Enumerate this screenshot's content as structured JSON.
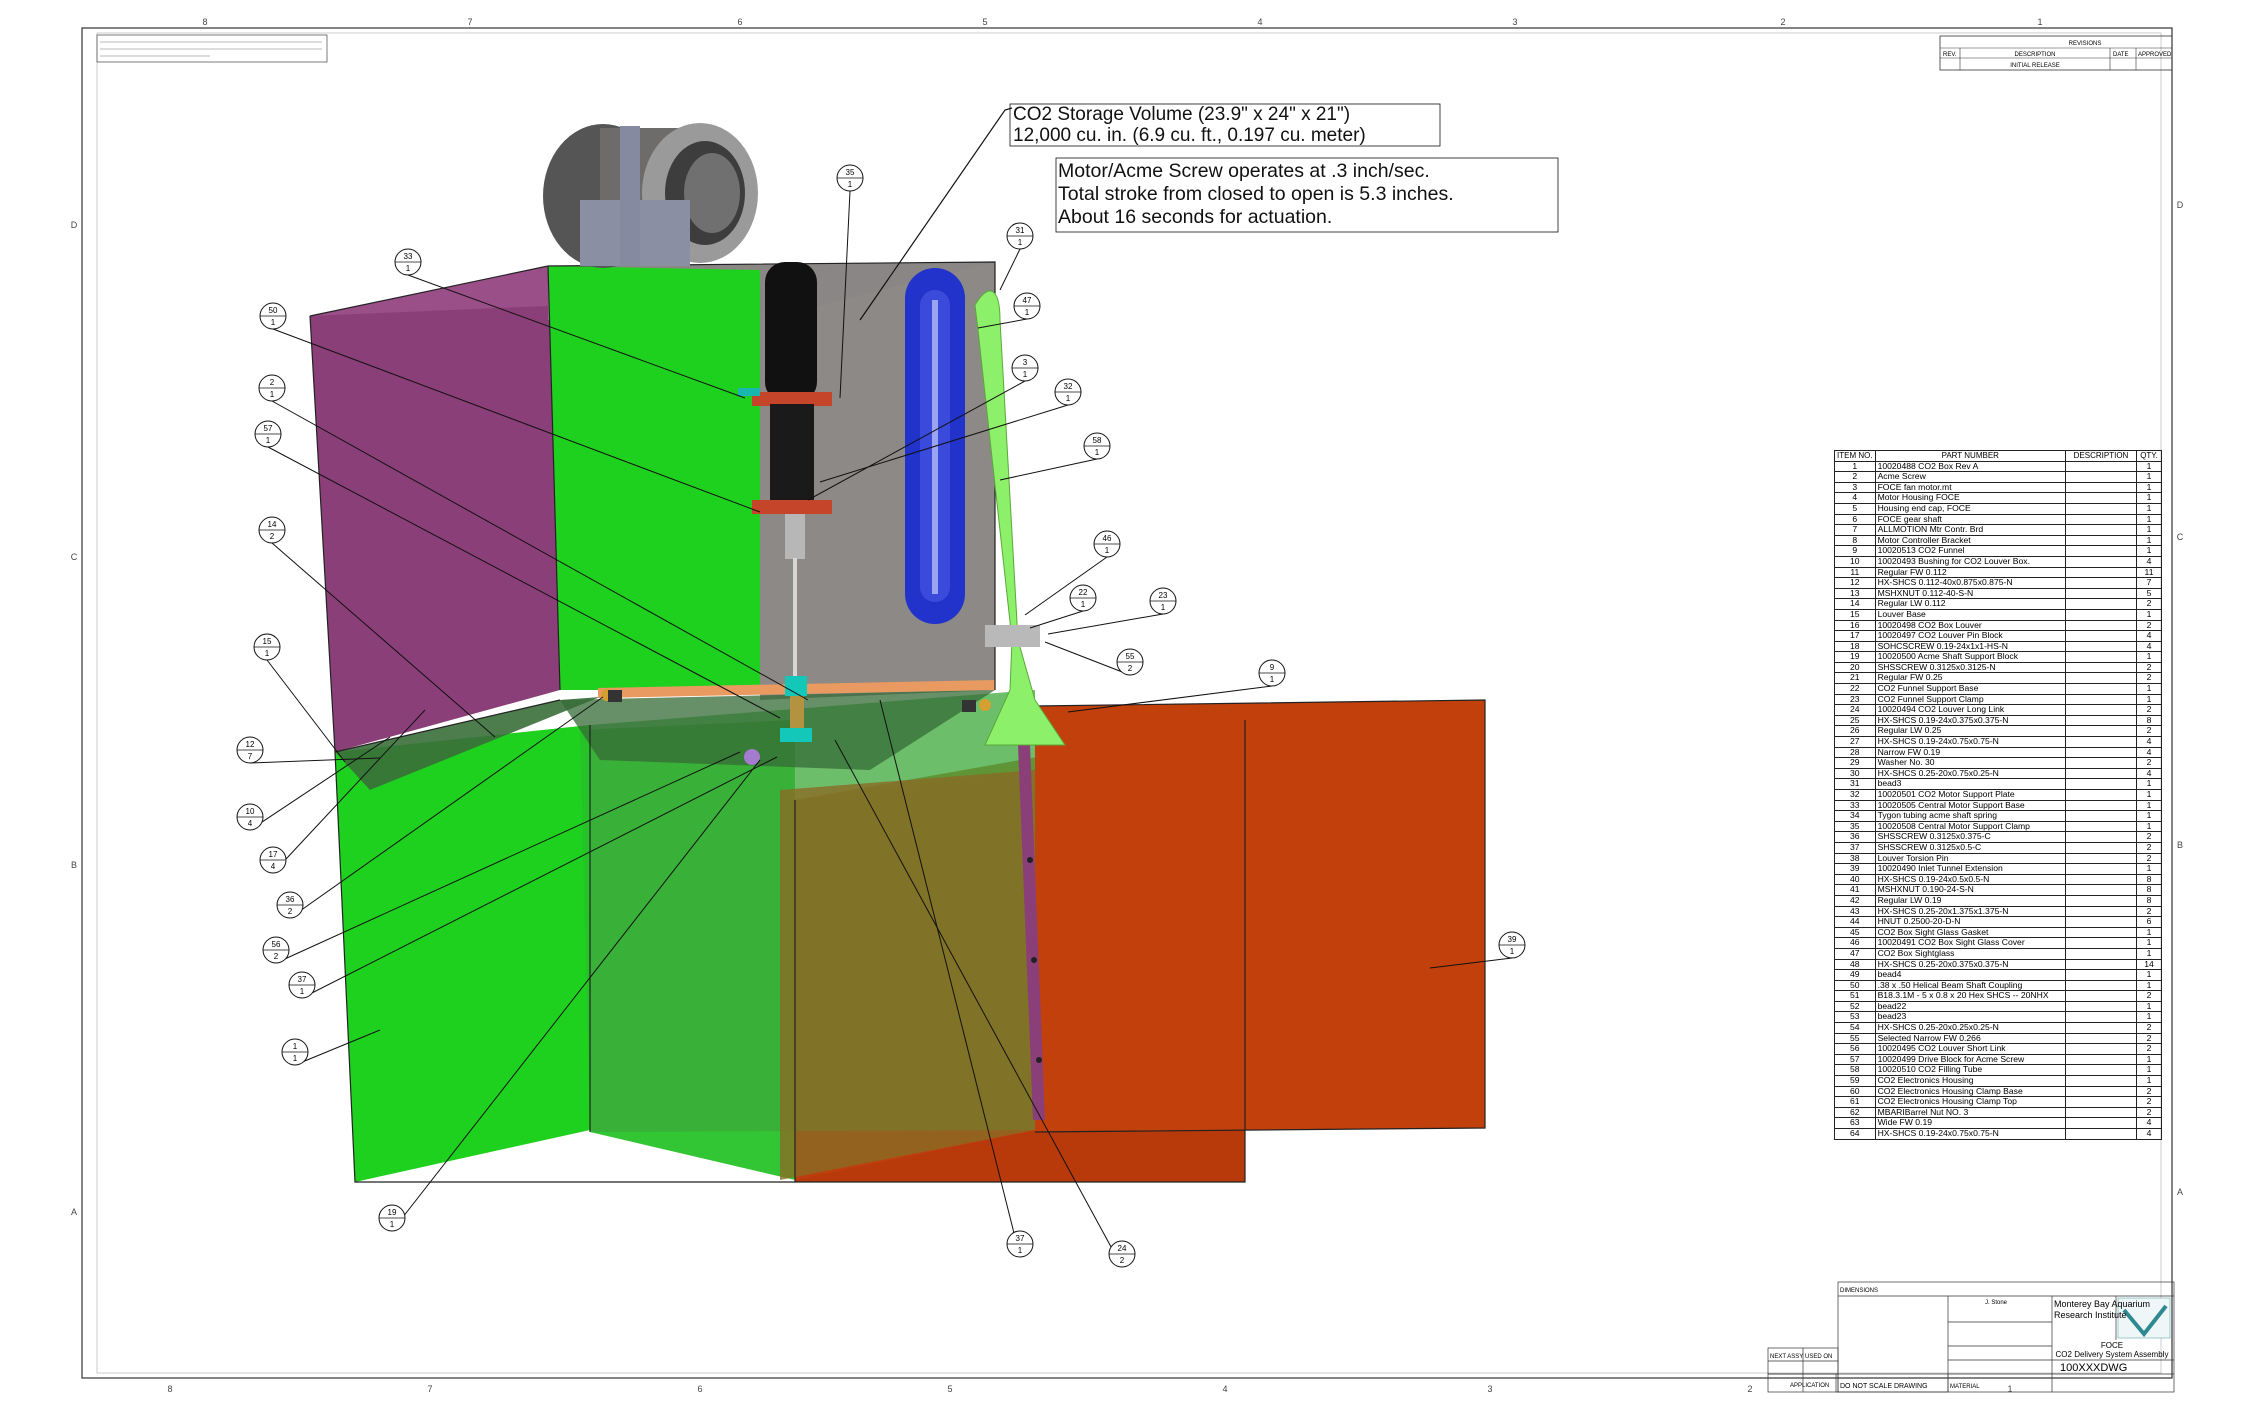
{
  "notes": {
    "storage_line1": "CO2 Storage Volume (23.9\" x 24\" x 21\")",
    "storage_line2": "12,000 cu. in. (6.9 cu. ft., 0.197 cu. meter)",
    "motor_line1": "Motor/Acme Screw  operates at .3 inch/sec.",
    "motor_line2": "Total stroke from closed to open is 5.3 inches.",
    "motor_line3": "About 16 seconds for actuation."
  },
  "colors": {
    "green": "#1fd11f",
    "purple": "#8b3f78",
    "orange": "#c2400c",
    "gray": "#8a8685",
    "blue": "#2233cc",
    "light_green": "#8df06a"
  },
  "balloons": [
    {
      "num": "35",
      "qty": "1"
    },
    {
      "num": "33",
      "qty": "1"
    },
    {
      "num": "50",
      "qty": "1"
    },
    {
      "num": "2",
      "qty": "1"
    },
    {
      "num": "57",
      "qty": "1"
    },
    {
      "num": "14",
      "qty": "2"
    },
    {
      "num": "15",
      "qty": "1"
    },
    {
      "num": "12",
      "qty": "7"
    },
    {
      "num": "10",
      "qty": "4"
    },
    {
      "num": "17",
      "qty": "4"
    },
    {
      "num": "36",
      "qty": "2"
    },
    {
      "num": "56",
      "qty": "2"
    },
    {
      "num": "37",
      "qty": "1"
    },
    {
      "num": "1",
      "qty": "1"
    },
    {
      "num": "19",
      "qty": "1"
    },
    {
      "num": "37",
      "qty": "1"
    },
    {
      "num": "24",
      "qty": "2"
    },
    {
      "num": "31",
      "qty": "1"
    },
    {
      "num": "47",
      "qty": "1"
    },
    {
      "num": "3",
      "qty": "1"
    },
    {
      "num": "32",
      "qty": "1"
    },
    {
      "num": "58",
      "qty": "1"
    },
    {
      "num": "46",
      "qty": "1"
    },
    {
      "num": "22",
      "qty": "1"
    },
    {
      "num": "23",
      "qty": "1"
    },
    {
      "num": "55",
      "qty": "2"
    },
    {
      "num": "9",
      "qty": "1"
    },
    {
      "num": "39",
      "qty": "1"
    }
  ],
  "border_letters": {
    "left": [
      "D",
      "C",
      "B",
      "A"
    ],
    "right": [
      "D",
      "C",
      "B",
      "A"
    ],
    "top": [
      "8",
      "7",
      "6",
      "5",
      "4",
      "3",
      "2",
      "1"
    ],
    "bottom": [
      "8",
      "7",
      "6",
      "5",
      "4",
      "3",
      "2",
      "1"
    ]
  },
  "bom": {
    "headers": [
      "ITEM NO.",
      "PART NUMBER",
      "DESCRIPTION",
      "QTY."
    ],
    "rows": [
      [
        "1",
        "10020488 CO2 Box Rev A",
        "",
        "1"
      ],
      [
        "2",
        "Acme Screw",
        "",
        "1"
      ],
      [
        "3",
        "FOCE fan motor.mt",
        "",
        "1"
      ],
      [
        "4",
        "Motor Housing FOCE",
        "",
        "1"
      ],
      [
        "5",
        "Housing end cap, FOCE",
        "",
        "1"
      ],
      [
        "6",
        "FOCE gear shaft",
        "",
        "1"
      ],
      [
        "7",
        "ALLMOTION Mtr Contr. Brd",
        "",
        "1"
      ],
      [
        "8",
        "Motor Controller Bracket",
        "",
        "1"
      ],
      [
        "9",
        "10020513 CO2 Funnel",
        "",
        "1"
      ],
      [
        "10",
        "10020493 Bushing for CO2 Louver Box.",
        "",
        "4"
      ],
      [
        "11",
        "Regular FW 0.112",
        "",
        "11"
      ],
      [
        "12",
        "HX-SHCS 0.112-40x0.875x0.875-N",
        "",
        "7"
      ],
      [
        "13",
        "MSHXNUT 0.112-40-S-N",
        "",
        "5"
      ],
      [
        "14",
        "Regular LW 0.112",
        "",
        "2"
      ],
      [
        "15",
        "Louver Base",
        "",
        "1"
      ],
      [
        "16",
        "10020498 CO2 Box Louver",
        "",
        "2"
      ],
      [
        "17",
        "10020497 CO2 Louver Pin Block",
        "",
        "4"
      ],
      [
        "18",
        "SOHCSCREW 0.19-24x1x1-HS-N",
        "",
        "4"
      ],
      [
        "19",
        "10020500 Acme Shaft Support Block",
        "",
        "1"
      ],
      [
        "20",
        "SHSSCREW 0.3125x0.3125-N",
        "",
        "2"
      ],
      [
        "21",
        "Regular FW 0.25",
        "",
        "2"
      ],
      [
        "22",
        "CO2 Funnel Support Base",
        "",
        "1"
      ],
      [
        "23",
        "CO2 Funnel Support Clamp",
        "",
        "1"
      ],
      [
        "24",
        "10020494 CO2 Louver Long Link",
        "",
        "2"
      ],
      [
        "25",
        "HX-SHCS 0.19-24x0.375x0.375-N",
        "",
        "8"
      ],
      [
        "26",
        "Regular LW 0.25",
        "",
        "2"
      ],
      [
        "27",
        "HX-SHCS 0.19-24x0.75x0.75-N",
        "",
        "4"
      ],
      [
        "28",
        "Narrow FW 0.19",
        "",
        "4"
      ],
      [
        "29",
        "Washer No. 30",
        "",
        "2"
      ],
      [
        "30",
        "HX-SHCS 0.25-20x0.75x0.25-N",
        "",
        "4"
      ],
      [
        "31",
        "bead3",
        "",
        "1"
      ],
      [
        "32",
        "10020501 CO2 Motor Support Plate",
        "",
        "1"
      ],
      [
        "33",
        "10020505 Central Motor Support Base",
        "",
        "1"
      ],
      [
        "34",
        "Tygon tubing acme shaft spring",
        "",
        "1"
      ],
      [
        "35",
        "10020508 Central Motor Support Clamp",
        "",
        "1"
      ],
      [
        "36",
        "SHSSCREW 0.3125x0.375-C",
        "",
        "2"
      ],
      [
        "37",
        "SHSSCREW 0.3125x0.5-C",
        "",
        "2"
      ],
      [
        "38",
        "Louver Torsion Pin",
        "",
        "2"
      ],
      [
        "39",
        "10020490 Inlet Tunnel Extension",
        "",
        "1"
      ],
      [
        "40",
        "HX-SHCS 0.19-24x0.5x0.5-N",
        "",
        "8"
      ],
      [
        "41",
        "MSHXNUT 0.190-24-S-N",
        "",
        "8"
      ],
      [
        "42",
        "Regular LW 0.19",
        "",
        "8"
      ],
      [
        "43",
        "HX-SHCS 0.25-20x1.375x1.375-N",
        "",
        "2"
      ],
      [
        "44",
        "HNUT 0.2500-20-D-N",
        "",
        "6"
      ],
      [
        "45",
        "CO2 Box Sight Glass Gasket",
        "",
        "1"
      ],
      [
        "46",
        "10020491 CO2 Box Sight Glass Cover",
        "",
        "1"
      ],
      [
        "47",
        "CO2 Box Sightglass",
        "",
        "1"
      ],
      [
        "48",
        "HX-SHCS 0.25-20x0.375x0.375-N",
        "",
        "14"
      ],
      [
        "49",
        "bead4",
        "",
        "1"
      ],
      [
        "50",
        ".38 x .50 Helical Beam Shaft Coupling",
        "",
        "1"
      ],
      [
        "51",
        "B18.3.1M - 5 x 0.8 x 20 Hex SHCS -- 20NHX",
        "",
        "2"
      ],
      [
        "52",
        "bead22",
        "",
        "1"
      ],
      [
        "53",
        "bead23",
        "",
        "1"
      ],
      [
        "54",
        "HX-SHCS 0.25-20x0.25x0.25-N",
        "",
        "2"
      ],
      [
        "55",
        "Selected Narrow FW 0.266",
        "",
        "2"
      ],
      [
        "56",
        "10020495 CO2 Louver Short Link",
        "",
        "2"
      ],
      [
        "57",
        "10020499 Drive Block for Acme Screw",
        "",
        "1"
      ],
      [
        "58",
        "10020510 CO2 Filling Tube",
        "",
        "1"
      ],
      [
        "59",
        "CO2 Electronics Housing",
        "",
        "1"
      ],
      [
        "60",
        "CO2 Electronics Housing Clamp Base",
        "",
        "2"
      ],
      [
        "61",
        "CO2 Electronics Housing Clamp Top",
        "",
        "2"
      ],
      [
        "62",
        "MBARIBarrel Nut NO. 3",
        "",
        "2"
      ],
      [
        "63",
        "Wide FW 0.19",
        "",
        "4"
      ],
      [
        "64",
        "HX-SHCS 0.19-24x0.75x0.75-N",
        "",
        "4"
      ]
    ]
  },
  "title_block": {
    "company_line1": "Monterey Bay Aquarium",
    "company_line2": "Research Institute",
    "project": "FOCE",
    "title": "CO2 Delivery System Assembly",
    "dwg_no": "100XXXDWG",
    "do_not_scale": "DO NOT SCALE DRAWING",
    "next_assy": "NEXT ASSY",
    "used_on": "USED ON",
    "application": "APPLICATION",
    "material": "MATERIAL",
    "drawn_by": "J. Stone",
    "dims": "DIMENSIONS"
  },
  "rev_block": {
    "title": "REVISIONS",
    "rev": "REV.",
    "desc": "DESCRIPTION",
    "date": "DATE",
    "approved": "APPROVED",
    "initial": "INITIAL RELEASE"
  }
}
